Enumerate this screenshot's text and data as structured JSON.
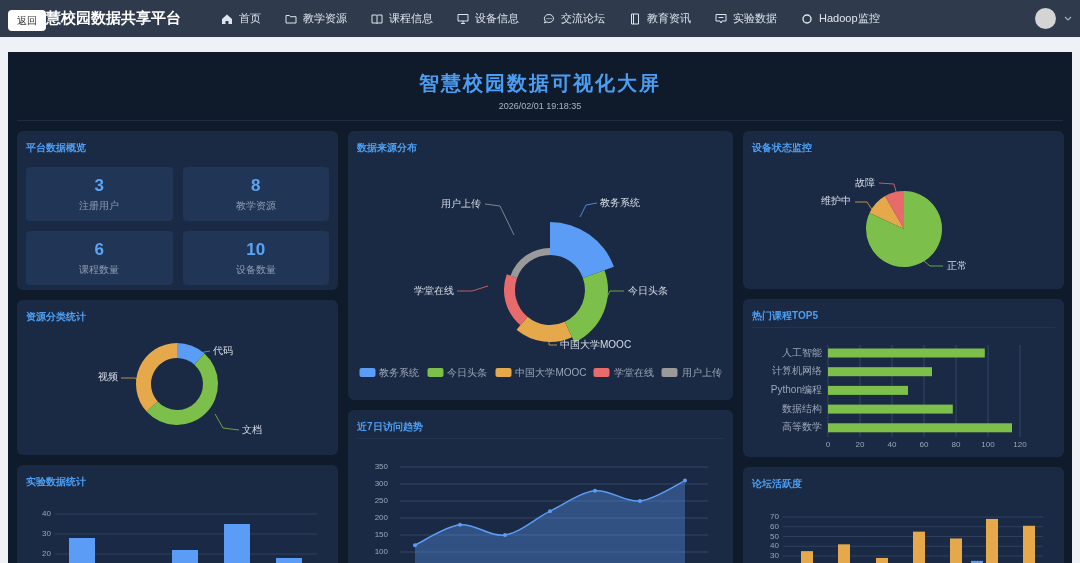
{
  "nav": {
    "back_button": "返回",
    "brand": "慧校园数据共享平台",
    "items": [
      "首页",
      "教学资源",
      "课程信息",
      "设备信息",
      "交流论坛",
      "教育资讯",
      "实验数据",
      "Hadoop监控"
    ]
  },
  "screen": {
    "title": "智慧校园数据可视化大屏",
    "datetime": "2026/02/01 19:18:35"
  },
  "overview": {
    "title": "平台数据概览",
    "stats": [
      {
        "value": "3",
        "label": "注册用户"
      },
      {
        "value": "8",
        "label": "教学资源"
      },
      {
        "value": "6",
        "label": "课程数量"
      },
      {
        "value": "10",
        "label": "设备数量"
      }
    ]
  },
  "resource_categories": {
    "title": "资源分类统计",
    "segments": [
      {
        "label": "代码",
        "color": "#5b9cf6"
      },
      {
        "label": "文档",
        "color": "#7cc04b"
      },
      {
        "label": "视频",
        "color": "#e5a84b"
      }
    ]
  },
  "experiment_data": {
    "title": "实验数据统计",
    "chart_data": {
      "type": "bar",
      "ylim": [
        0,
        40
      ],
      "yticks": [
        20,
        30,
        40
      ],
      "grid": true,
      "series": [
        {
          "color": "#5b9cf6",
          "values": [
            28,
            null,
            22,
            35,
            18
          ]
        }
      ]
    }
  },
  "data_sources": {
    "title": "数据来源分布",
    "segments": [
      {
        "label": "教务系统",
        "color": "#5b9cf6"
      },
      {
        "label": "今日头条",
        "color": "#7cc04b"
      },
      {
        "label": "中国大学MOOC",
        "color": "#e5a84b"
      },
      {
        "label": "学堂在线",
        "color": "#e86b6b"
      },
      {
        "label": "用户上传",
        "color": "#9a9a9a"
      }
    ],
    "legend": [
      {
        "label": "教务系统",
        "color": "#5b9cf6"
      },
      {
        "label": "今日头条",
        "color": "#7cc04b"
      },
      {
        "label": "中国大学MOOC",
        "color": "#e5a84b"
      },
      {
        "label": "学堂在线",
        "color": "#e86b6b"
      },
      {
        "label": "用户上传",
        "color": "#9a9a9a"
      }
    ]
  },
  "visit_trend": {
    "title": "近7日访问趋势",
    "chart_data": {
      "type": "area",
      "ylim": [
        0,
        350
      ],
      "yticks": [
        100,
        150,
        200,
        250,
        300,
        350
      ],
      "grid": true,
      "series": [
        {
          "color": "#5b9cf6",
          "values": [
            120,
            180,
            150,
            220,
            280,
            250,
            310
          ]
        }
      ]
    }
  },
  "device_status": {
    "title": "设备状态监控",
    "segments": [
      {
        "label": "故障",
        "color": "#e86b6b"
      },
      {
        "label": "维护中",
        "color": "#e5a84b"
      },
      {
        "label": "正常",
        "color": "#7cc04b"
      }
    ]
  },
  "top_courses": {
    "title": "热门课程TOP5",
    "chart_data": {
      "type": "bar",
      "orientation": "horizontal",
      "categories": [
        "人工智能",
        "计算机网络",
        "Python编程",
        "数据结构",
        "高等数学"
      ],
      "values": [
        98,
        65,
        50,
        78,
        115
      ],
      "xlim": [
        0,
        120
      ],
      "xticks": [
        0,
        20,
        40,
        60,
        80,
        100,
        120
      ],
      "grid": true
    }
  },
  "forum_activity": {
    "title": "论坛活跃度",
    "chart_data": {
      "type": "bar",
      "ylim": [
        0,
        70
      ],
      "yticks": [
        30,
        40,
        50,
        60,
        70
      ],
      "grid": true,
      "series": [
        {
          "color": "#5b9cf6",
          "values": [
            null,
            null,
            null,
            null,
            null,
            25,
            null
          ]
        },
        {
          "color": "#e5a84b",
          "values": [
            35,
            42,
            28,
            55,
            48,
            68,
            61
          ]
        }
      ]
    }
  }
}
